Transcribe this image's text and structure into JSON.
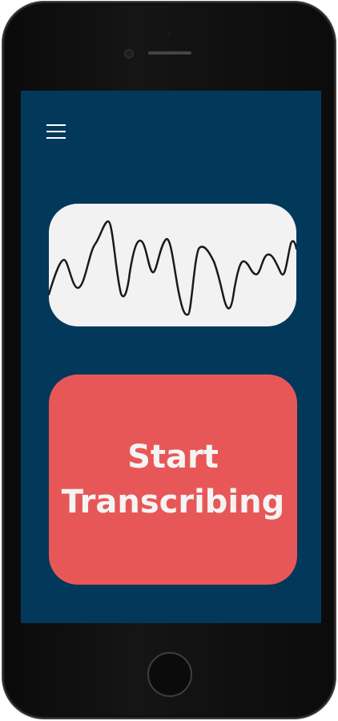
{
  "app": {
    "start_button_label": "Start Transcribing"
  },
  "icons": {
    "menu": "hamburger-icon",
    "waveform": "waveform-icon"
  },
  "colors": {
    "screen_background": "#02385a",
    "waveform_card": "#f2f2f2",
    "start_button": "#e85758",
    "start_button_text": "#f4f4f4",
    "menu_icon": "#ffffff"
  }
}
